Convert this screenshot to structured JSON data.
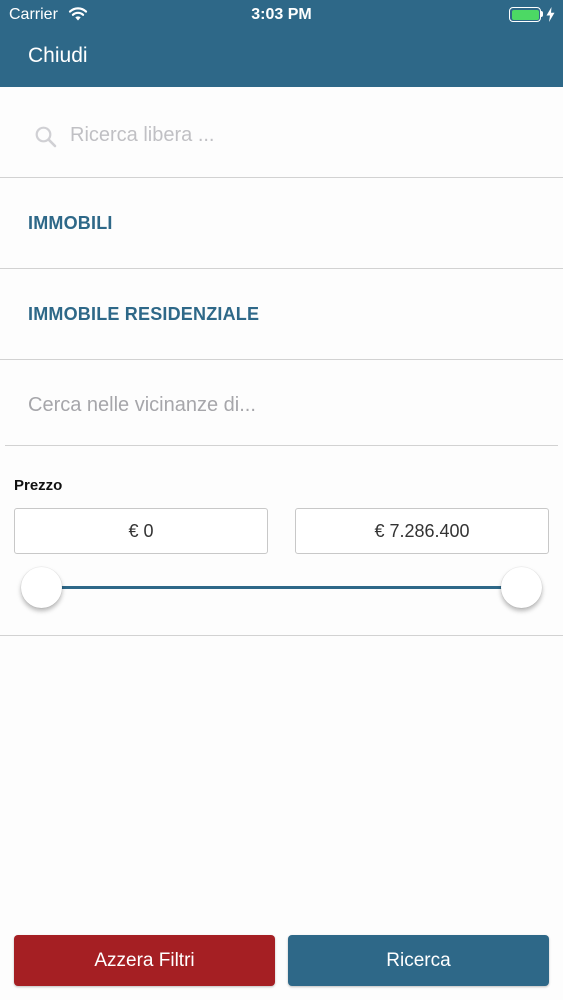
{
  "status_bar": {
    "carrier": "Carrier",
    "time": "3:03 PM",
    "battery_color": "#4cd964"
  },
  "header": {
    "close_label": "Chiudi",
    "color": "#2e6888"
  },
  "search": {
    "placeholder": "Ricerca libera ..."
  },
  "categories": [
    {
      "label": "IMMOBILI"
    },
    {
      "label": "IMMOBILE RESIDENZIALE"
    }
  ],
  "nearby": {
    "placeholder": "Cerca nelle vicinanze di..."
  },
  "price": {
    "label": "Prezzo",
    "min_value": "€ 0",
    "max_value": "€ 7.286.400",
    "range_selected_fraction": [
      0,
      1
    ]
  },
  "actions": {
    "reset_label": "Azzera Filtri",
    "reset_color": "#a51f23",
    "search_label": "Ricerca",
    "search_color": "#2e6888"
  }
}
